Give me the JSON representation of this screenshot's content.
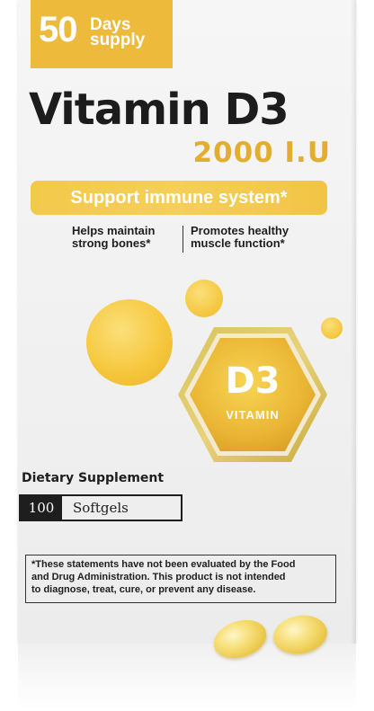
{
  "badge": {
    "number": "50",
    "text": "Days supply"
  },
  "product": {
    "name": "Vitamin D3",
    "strength": "2000 I.U"
  },
  "banner": {
    "text": "Support immune system*"
  },
  "claims": {
    "left_line1": "Helps maintain",
    "left_line2": "strong bones*",
    "right_line1": "Promotes healthy",
    "right_line2": "muscle function*"
  },
  "hexagon": {
    "main": "D3",
    "sub": "VITAMIN"
  },
  "supplement_label": "Dietary Supplement",
  "count": {
    "number": "100",
    "label": "Softgels"
  },
  "disclaimer": {
    "line1": "*These statements have not been evaluated by the Food",
    "line2": "and Drug Administration. This product is not intended",
    "line3": "to diagnose, treat, cure, or prevent any disease."
  },
  "colors": {
    "accent": "#edba3c",
    "banner": "#f3c94b",
    "strength": "#e3ad2f",
    "text": "#1e1e1e"
  }
}
